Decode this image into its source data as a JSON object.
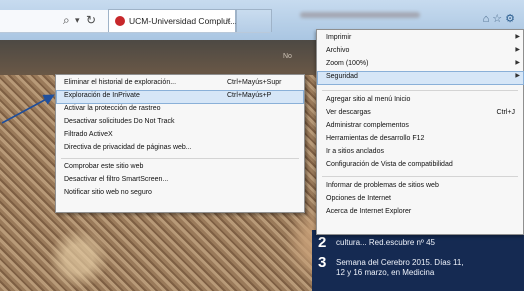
{
  "browser": {
    "tab_title": "UCM-Universidad Complut...",
    "tab_close": "×",
    "nav_search_glyph": "⌕",
    "nav_dropdown_glyph": "▾",
    "nav_refresh_glyph": "↻",
    "window_icons": [
      "home-icon",
      "star-icon",
      "gear-icon"
    ],
    "header_fragment": "No"
  },
  "tools_menu": {
    "items": [
      {
        "label": "Imprimir",
        "has_submenu": true
      },
      {
        "label": "Archivo",
        "has_submenu": true
      },
      {
        "label": "Zoom (100%)",
        "has_submenu": true
      },
      {
        "label": "Seguridad",
        "has_submenu": true,
        "highlighted": true
      },
      {
        "label": "Agregar sitio al menú Inicio"
      },
      {
        "label": "Ver descargas",
        "shortcut": "Ctrl+J"
      },
      {
        "label": "Administrar complementos"
      },
      {
        "label": "Herramientas de desarrollo F12"
      },
      {
        "label": "Ir a sitios anclados"
      },
      {
        "label": "Configuración de Vista de compatibilidad"
      },
      {
        "label": "Informar de problemas de sitios web"
      },
      {
        "label": "Opciones de Internet"
      },
      {
        "label": "Acerca de Internet Explorer"
      }
    ]
  },
  "security_submenu": {
    "items": [
      {
        "label": "Eliminar el historial de exploración...",
        "shortcut": "Ctrl+Mayús+Supr"
      },
      {
        "label": "Exploración de InPrivate",
        "shortcut": "Ctrl+Mayús+P",
        "highlighted": true
      },
      {
        "label": "Activar la protección de rastreo"
      },
      {
        "label": "Desactivar solicitudes Do Not Track"
      },
      {
        "label": "Filtrado ActiveX"
      },
      {
        "label": "Directiva de privacidad de páginas web..."
      },
      {
        "label": "Comprobar este sitio web"
      },
      {
        "label": "Desactivar el filtro SmartScreen..."
      },
      {
        "label": "Notificar sitio web no seguro"
      }
    ]
  },
  "news": [
    {
      "num": "2",
      "lines": [
        "cultura... Red.escubre nº 45"
      ]
    },
    {
      "num": "3",
      "lines": [
        "Semana del Cerebro 2015. Días 11,",
        "12 y 16 marzo, en Medicina"
      ]
    }
  ],
  "colors": {
    "menu_highlight": "#d6e6f7",
    "annotation_arrow": "#1f4f9c",
    "news_panel": "#152a52"
  }
}
